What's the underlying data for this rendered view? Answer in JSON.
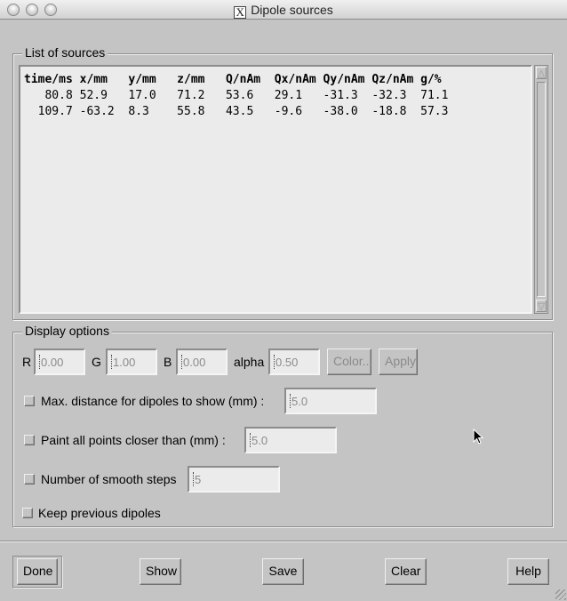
{
  "window": {
    "title": "Dipole sources",
    "app_icon": "x11-icon"
  },
  "sources": {
    "frame_label": "List of sources",
    "columns": [
      "time/ms",
      "x/mm",
      "y/mm",
      "z/mm",
      "Q/nAm",
      "Qx/nAm",
      "Qy/nAm",
      "Qz/nAm",
      "g/%"
    ],
    "header_text": "time/ms x/mm   y/mm   z/mm   Q/nAm  Qx/nAm Qy/nAm Qz/nAm g/%",
    "rows": [
      {
        "time": "80.8",
        "x": "52.9",
        "y": "17.0",
        "z": "71.2",
        "Q": "53.6",
        "Qx": "29.1",
        "Qy": "-31.3",
        "Qz": "-32.3",
        "g": "71.1"
      },
      {
        "time": "109.7",
        "x": "-63.2",
        "y": "8.3",
        "z": "55.8",
        "Q": "43.5",
        "Qx": "-9.6",
        "Qy": "-38.0",
        "Qz": "-18.8",
        "g": "57.3"
      }
    ],
    "row_texts": [
      "   80.8 52.9   17.0   71.2   53.6   29.1   -31.3  -32.3  71.1",
      "  109.7 -63.2  8.3    55.8   43.5   -9.6   -38.0  -18.8  57.3"
    ]
  },
  "display": {
    "frame_label": "Display options",
    "r_label": "R",
    "r_value": "0.00",
    "g_label": "G",
    "g_value": "1.00",
    "b_label": "B",
    "b_value": "0.00",
    "alpha_label": "alpha",
    "alpha_value": "0.50",
    "color_button": "Color...",
    "apply_button": "Apply",
    "max_distance_label": "Max. distance for dipoles to show (mm) :",
    "max_distance_value": "5.0",
    "max_distance_checked": false,
    "paint_closer_label": "Paint all points closer than (mm) :",
    "paint_closer_value": "5.0",
    "paint_closer_checked": false,
    "smooth_steps_label": "Number of smooth steps",
    "smooth_steps_value": "5",
    "smooth_steps_checked": false,
    "keep_previous_label": "Keep previous dipoles",
    "keep_previous_checked": false
  },
  "buttons": {
    "done": "Done",
    "show": "Show",
    "save": "Save",
    "clear": "Clear",
    "help": "Help"
  }
}
